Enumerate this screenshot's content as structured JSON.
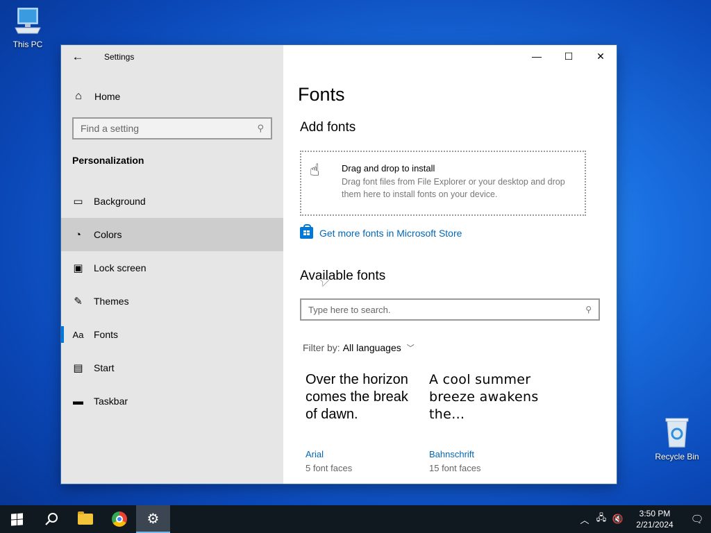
{
  "desktop": {
    "icons": [
      {
        "label": "This PC"
      },
      {
        "label": "Recycle Bin"
      }
    ]
  },
  "window": {
    "title": "Settings",
    "home_label": "Home",
    "search_placeholder": "Find a setting",
    "section": "Personalization",
    "nav": [
      {
        "label": "Background",
        "icon": "image-icon"
      },
      {
        "label": "Colors",
        "icon": "palette-icon"
      },
      {
        "label": "Lock screen",
        "icon": "lock-screen-icon"
      },
      {
        "label": "Themes",
        "icon": "brush-icon"
      },
      {
        "label": "Fonts",
        "icon": "font-icon"
      },
      {
        "label": "Start",
        "icon": "start-icon"
      },
      {
        "label": "Taskbar",
        "icon": "taskbar-icon"
      }
    ],
    "hovered_item": "Colors",
    "selected_item": "Fonts"
  },
  "content": {
    "page_title": "Fonts",
    "add_heading": "Add fonts",
    "drop_title": "Drag and drop to install",
    "drop_desc": "Drag font files from File Explorer or your desktop and drop them here to install fonts on your device.",
    "store_link": "Get more fonts in Microsoft Store",
    "available_heading": "Available fonts",
    "font_search_placeholder": "Type here to search.",
    "filter_label": "Filter by:",
    "filter_value": "All languages",
    "fonts": [
      {
        "sample": "Over the horizon comes the break of dawn.",
        "name": "Arial",
        "faces": "5 font faces"
      },
      {
        "sample": "A cool summer breeze awakens the…",
        "name": "Bahnschrift",
        "faces": "15 font faces"
      }
    ]
  },
  "taskbar": {
    "time": "3:50 PM",
    "date": "2/21/2024"
  },
  "colors": {
    "accent": "#0078d7",
    "link": "#0067b8",
    "sidebar_bg": "#e6e6e6"
  }
}
